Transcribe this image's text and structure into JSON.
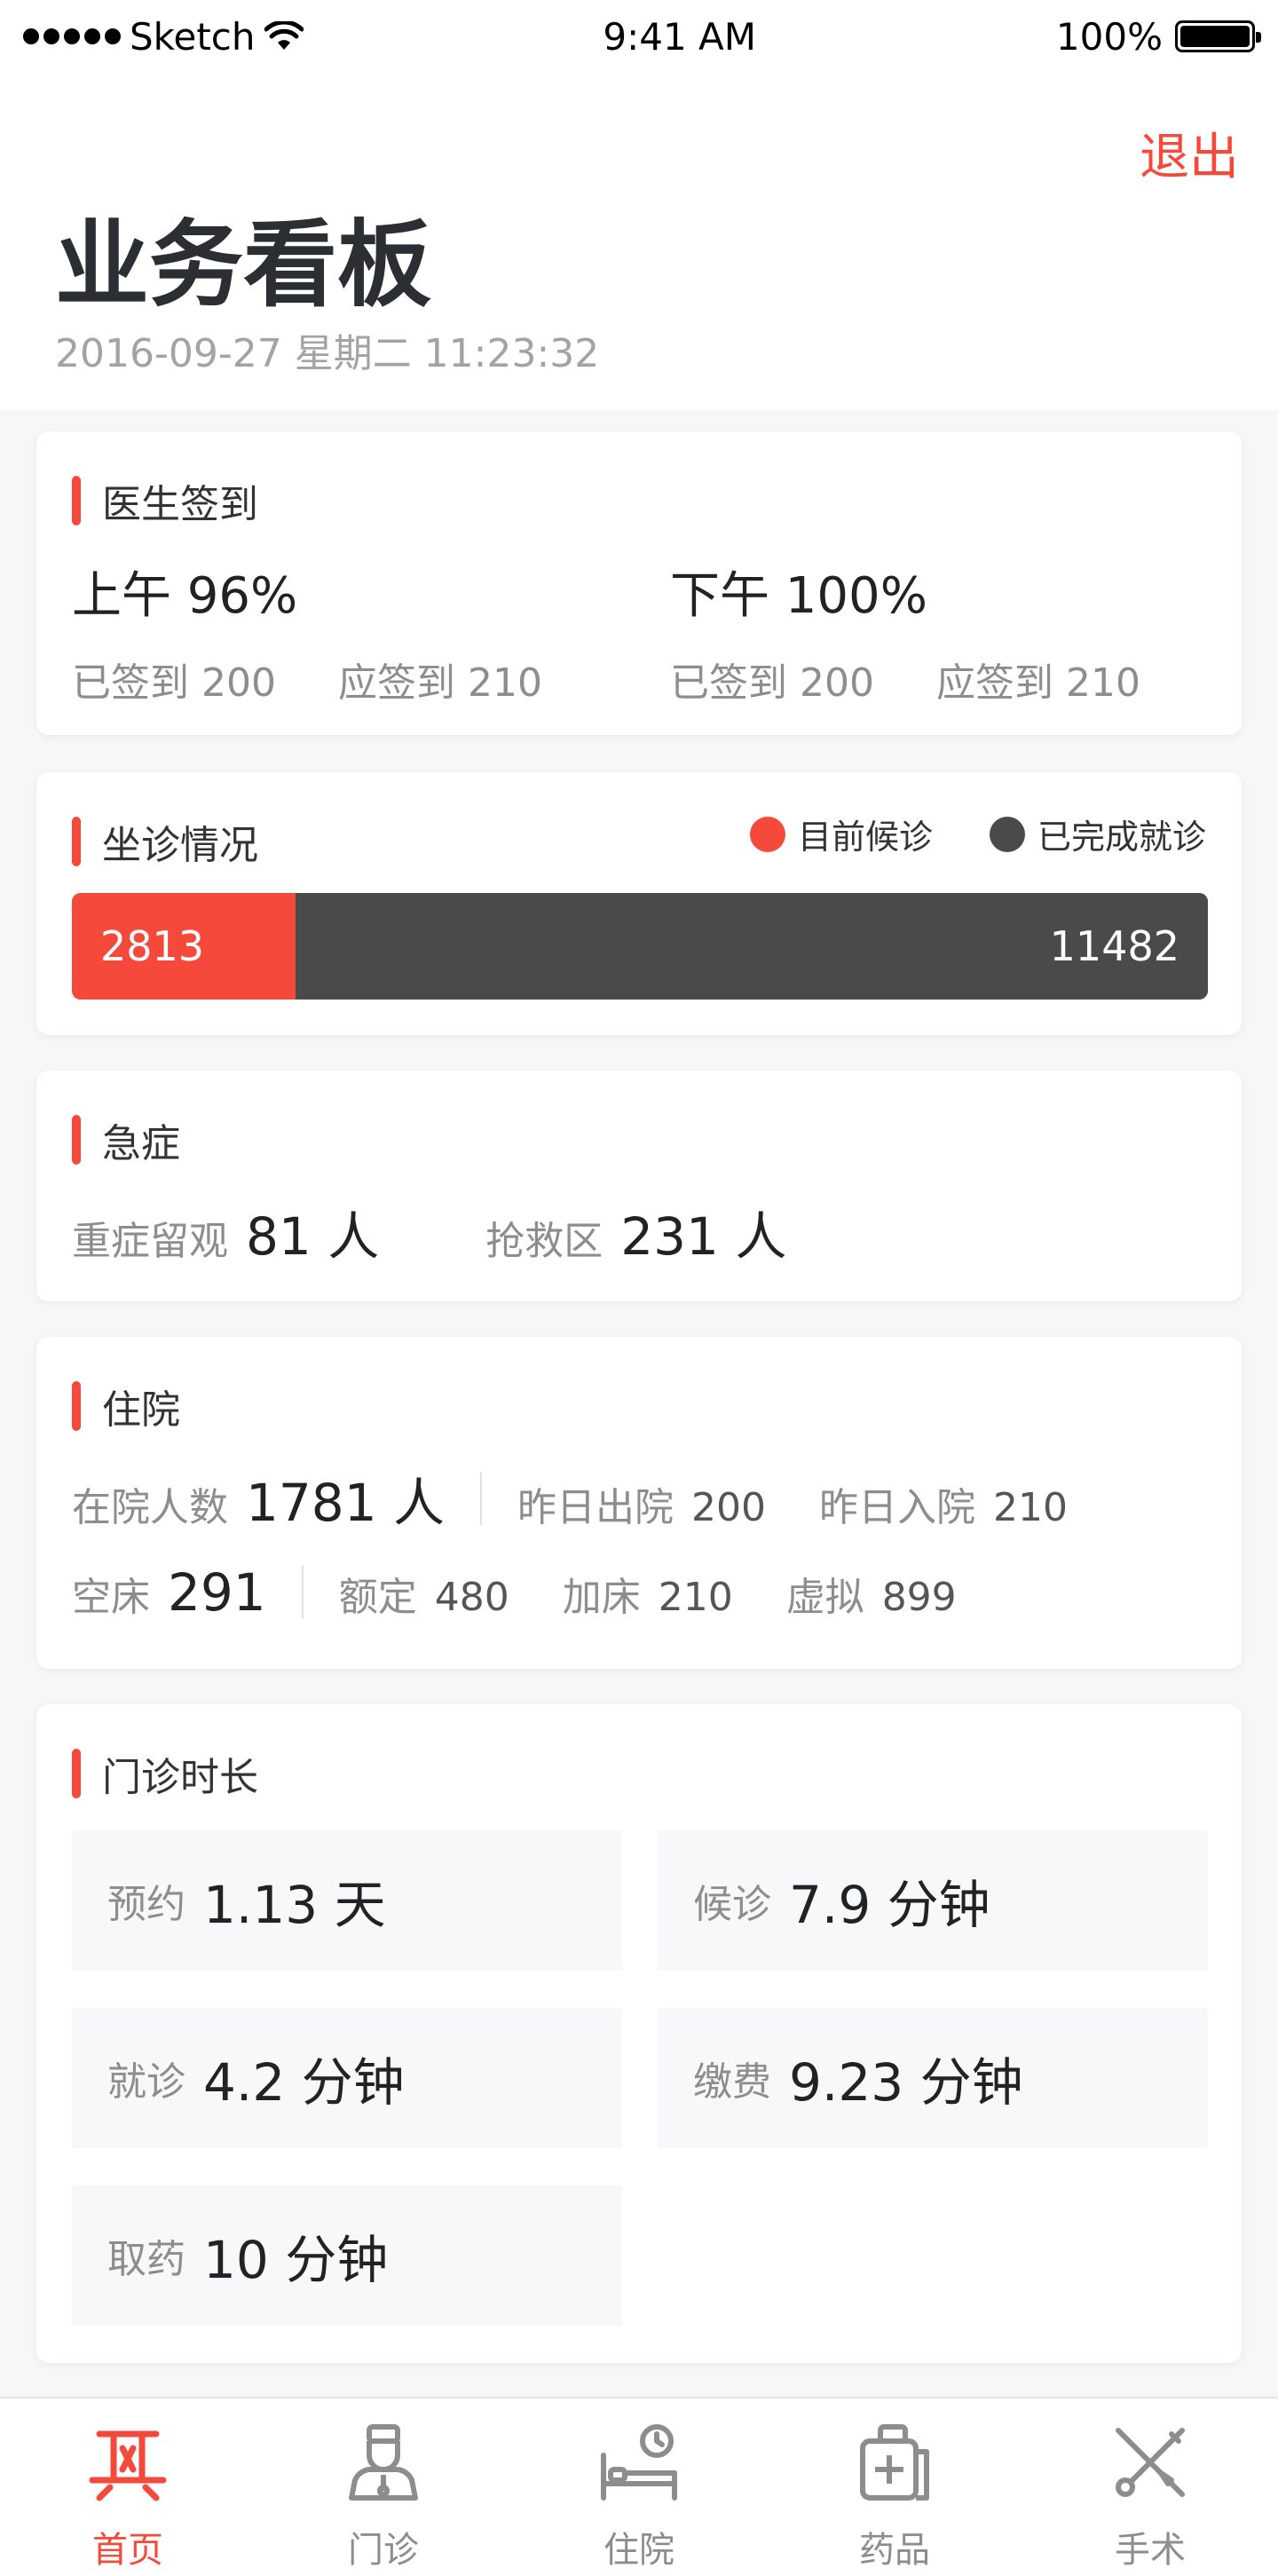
{
  "status_bar": {
    "carrier": "Sketch",
    "time": "9:41 AM",
    "battery": "100%"
  },
  "header": {
    "logout_label": "退出",
    "title": "业务看板",
    "datetime": "2016-09-27  星期二  11:23:32"
  },
  "signin": {
    "title": "医生签到",
    "morning": {
      "main": "上午 96%",
      "signed_label": "已签到",
      "signed": "200",
      "due_label": "应签到",
      "due": "210"
    },
    "afternoon": {
      "main": "下午 100%",
      "signed_label": "已签到",
      "signed": "200",
      "due_label": "应签到",
      "due": "210"
    }
  },
  "clinic": {
    "title": "坐诊情况",
    "legend_waiting": "目前候诊",
    "legend_done": "已完成就诊",
    "waiting": 2813,
    "done": 11482,
    "waiting_color": "#f5493c",
    "done_color": "#4a4a4a"
  },
  "emergency": {
    "title": "急症",
    "observation_label": "重症留观",
    "observation_value": "81 人",
    "rescue_label": "抢救区",
    "rescue_value": "231 人"
  },
  "inpatient": {
    "title": "住院",
    "in_label": "在院人数",
    "in_value": "1781 人",
    "discharged_label": "昨日出院",
    "discharged_value": "200",
    "admitted_label": "昨日入院",
    "admitted_value": "210",
    "empty_label": "空床",
    "empty_value": "291",
    "rated_label": "额定",
    "rated_value": "480",
    "extra_label": "加床",
    "extra_value": "210",
    "virtual_label": "虚拟",
    "virtual_value": "899"
  },
  "duration": {
    "title": "门诊时长",
    "items": [
      {
        "label": "预约",
        "value": "1.13 天"
      },
      {
        "label": "候诊",
        "value": "7.9 分钟"
      },
      {
        "label": "就诊",
        "value": "4.2 分钟"
      },
      {
        "label": "缴费",
        "value": "9.23 分钟"
      },
      {
        "label": "取药",
        "value": "10 分钟"
      }
    ]
  },
  "tabs": [
    {
      "label": "首页",
      "icon": "home-icon",
      "active": true
    },
    {
      "label": "门诊",
      "icon": "doctor-icon",
      "active": false
    },
    {
      "label": "住院",
      "icon": "bed-icon",
      "active": false
    },
    {
      "label": "药品",
      "icon": "medicine-kit-icon",
      "active": false
    },
    {
      "label": "手术",
      "icon": "surgery-tools-icon",
      "active": false
    }
  ],
  "colors": {
    "accent": "#f5493c",
    "dark": "#4a4a4a"
  }
}
